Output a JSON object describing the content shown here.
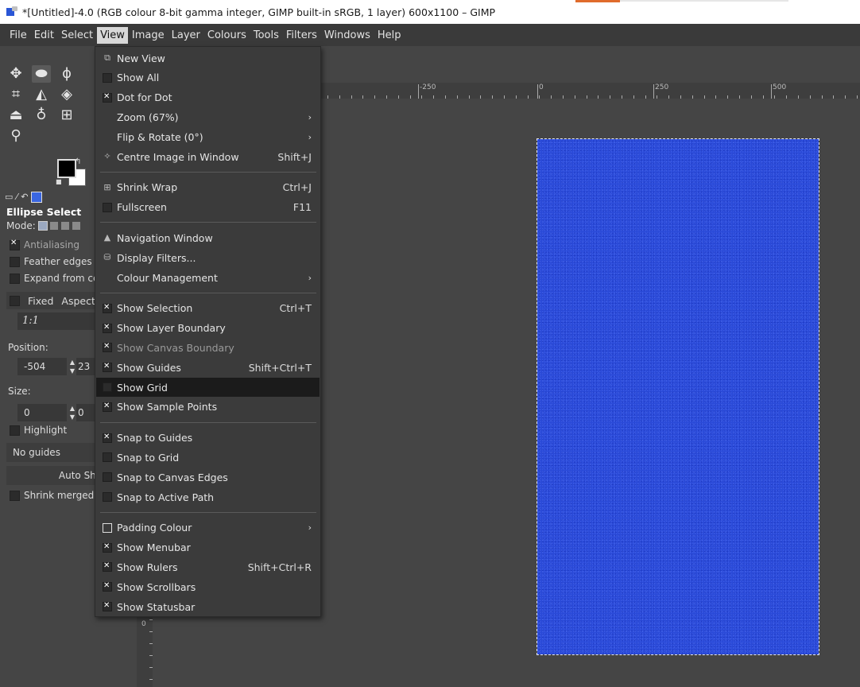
{
  "window": {
    "title": "*[Untitled]-4.0 (RGB colour 8-bit gamma integer, GIMP built-in sRGB, 1 layer) 600x1100 – GIMP"
  },
  "menubar": [
    "File",
    "Edit",
    "Select",
    "View",
    "Image",
    "Layer",
    "Colours",
    "Tools",
    "Filters",
    "Windows",
    "Help"
  ],
  "tool_options": {
    "title": "Ellipse Select",
    "mode_label": "Mode:",
    "antialiasing": "Antialiasing",
    "feather_edges": "Feather edges",
    "expand_from_center": "Expand from cen",
    "fixed": "Fixed",
    "aspect": "Aspect",
    "ratio": "1:1",
    "position_label": "Position:",
    "pos_x": "-504",
    "pos_y": "23",
    "size_label": "Size:",
    "size_w": "0",
    "size_h": "0",
    "highlight": "Highlight",
    "guides": "No guides",
    "auto_shrink": "Auto Shrinl",
    "shrink_merged": "Shrink merged"
  },
  "ruler": {
    "labels": [
      "-250",
      "0",
      "250",
      "500"
    ],
    "left_label": "0"
  },
  "view_menu": {
    "items": [
      {
        "label": "New View",
        "icon": "new-view-icon",
        "type": "glyph"
      },
      {
        "label": "Show All",
        "type": "box"
      },
      {
        "label": "Dot for Dot",
        "type": "xbox"
      },
      {
        "label": "Zoom (67%)",
        "type": "none",
        "submenu": true
      },
      {
        "label": "Flip & Rotate (0°)",
        "type": "none",
        "submenu": true
      },
      {
        "label": "Centre Image in Window",
        "type": "glyph",
        "icon": "centre-icon",
        "accel": "Shift+J"
      },
      {
        "label": "Shrink Wrap",
        "type": "glyph",
        "icon": "shrink-wrap-icon",
        "accel": "Ctrl+J"
      },
      {
        "label": "Fullscreen",
        "type": "box",
        "accel": "F11"
      },
      {
        "label": "Navigation Window",
        "type": "glyph",
        "icon": "navigation-icon"
      },
      {
        "label": "Display Filters...",
        "type": "glyph",
        "icon": "display-filters-icon"
      },
      {
        "label": "Colour Management",
        "type": "none",
        "submenu": true
      },
      {
        "label": "Show Selection",
        "type": "xbox",
        "accel": "Ctrl+T"
      },
      {
        "label": "Show Layer Boundary",
        "type": "xbox"
      },
      {
        "label": "Show Canvas Boundary",
        "type": "xbox",
        "dim": true
      },
      {
        "label": "Show Guides",
        "type": "xbox",
        "accel": "Shift+Ctrl+T"
      },
      {
        "label": "Show Grid",
        "type": "box",
        "highlight": true
      },
      {
        "label": "Show Sample Points",
        "type": "xbox"
      },
      {
        "label": "Snap to Guides",
        "type": "xbox"
      },
      {
        "label": "Snap to Grid",
        "type": "box"
      },
      {
        "label": "Snap to Canvas Edges",
        "type": "box"
      },
      {
        "label": "Snap to Active Path",
        "type": "box"
      },
      {
        "label": "Padding Colour",
        "type": "outline",
        "submenu": true
      },
      {
        "label": "Show Menubar",
        "type": "xbox"
      },
      {
        "label": "Show Rulers",
        "type": "xbox",
        "accel": "Shift+Ctrl+R"
      },
      {
        "label": "Show Scrollbars",
        "type": "xbox"
      },
      {
        "label": "Show Statusbar",
        "type": "xbox"
      }
    ]
  },
  "colors": {
    "canvas_blue": "#2a4ad8",
    "menu_bg": "#3b3b3b",
    "ui_bg": "#454545"
  }
}
